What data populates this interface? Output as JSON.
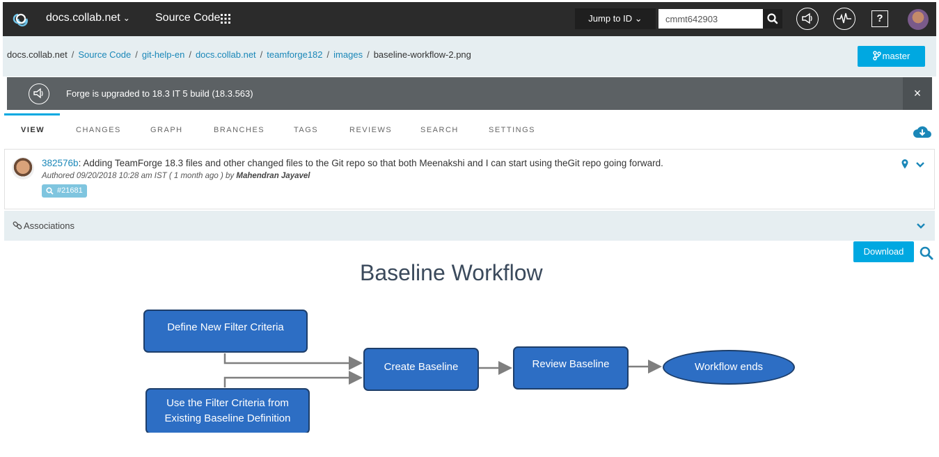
{
  "topbar": {
    "app_name": "docs.collab.net",
    "source_code": "Source Code",
    "jump_to": "Jump to ID",
    "jump_value": "cmmt642903"
  },
  "breadcrumb": {
    "root": "docs.collab.net",
    "items": [
      "Source Code",
      "git-help-en",
      "docs.collab.net",
      "teamforge182",
      "images"
    ],
    "current": "baseline-workflow-2.png"
  },
  "branch": {
    "label": "master"
  },
  "announcement": {
    "text": "Forge is upgraded to 18.3 IT 5 build (18.3.563)",
    "close": "×"
  },
  "tabs": [
    "VIEW",
    "CHANGES",
    "GRAPH",
    "BRANCHES",
    "TAGS",
    "REVIEWS",
    "SEARCH",
    "SETTINGS"
  ],
  "commit": {
    "hash": "382576b",
    "message": ": Adding TeamForge 18.3 files and other changed files to the Git repo so that both Meenakshi and I can start using theGit repo going forward.",
    "authored_prefix": "Authored  09/20/2018 10:28 am IST ( 1 month ago ) by ",
    "author": "Mahendran Jayavel",
    "artifact": "#21681"
  },
  "associations": {
    "label": "Associations"
  },
  "actions": {
    "download": "Download"
  },
  "image": {
    "title": "Baseline Workflow",
    "nodes": {
      "define": "Define New Filter Criteria",
      "use_line1": "Use the Filter Criteria from",
      "use_line2": "Existing Baseline Definition",
      "create": "Create Baseline",
      "review": "Review Baseline",
      "end": "Workflow ends"
    }
  },
  "colors": {
    "accent": "#00a8e1",
    "topbar": "#2b2b2b",
    "node_fill": "#2d6ec4",
    "link": "#1a87b8"
  }
}
